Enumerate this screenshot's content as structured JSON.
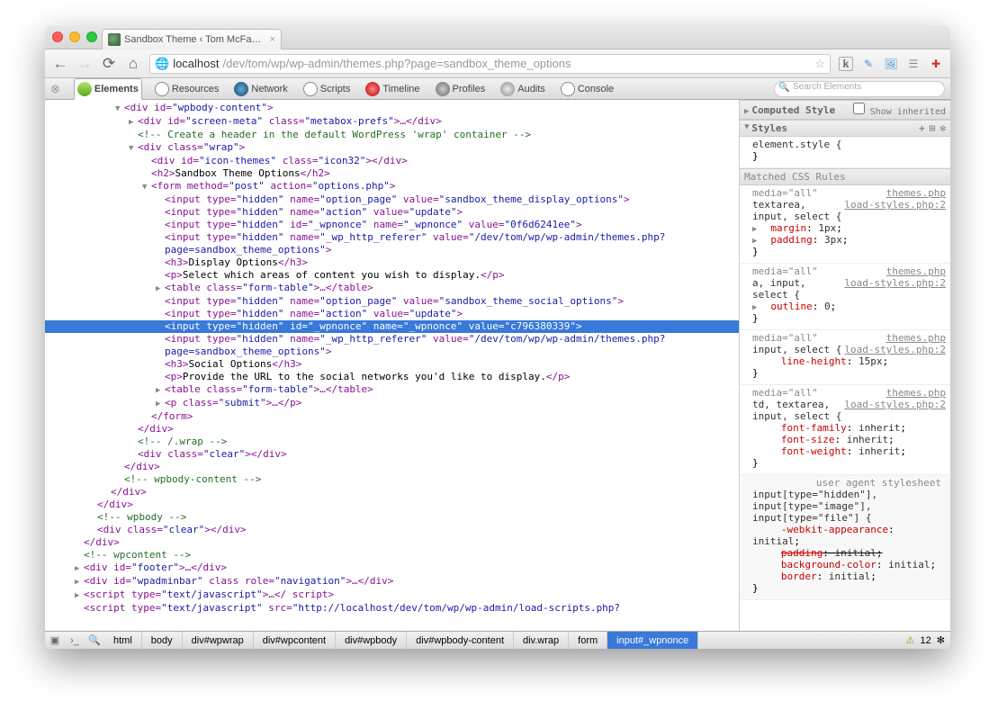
{
  "tab": {
    "title": "Sandbox Theme ‹ Tom McFa…",
    "close": "×"
  },
  "url": {
    "host": "localhost",
    "rest": "/dev/tom/wp/wp-admin/themes.php?page=sandbox_theme_options"
  },
  "dt_tabs": {
    "elements": "Elements",
    "resources": "Resources",
    "network": "Network",
    "scripts": "Scripts",
    "timeline": "Timeline",
    "profiles": "Profiles",
    "audits": "Audits",
    "console": "Console"
  },
  "dt_search_placeholder": "Search Elements",
  "dom": {
    "l0": [
      "<div id=",
      "\"wpbody-content\"",
      ">"
    ],
    "l1": [
      "<div id=",
      "\"screen-meta\"",
      " class=",
      "\"metabox-prefs\"",
      ">…</div>"
    ],
    "l2": "<!-- Create a header in the default WordPress 'wrap' container -->",
    "l3": [
      "<div class=",
      "\"wrap\"",
      ">"
    ],
    "l4": [
      "<div id=",
      "\"icon-themes\"",
      " class=",
      "\"icon32\"",
      "></div>"
    ],
    "l5": [
      "<h2>",
      "Sandbox Theme Options",
      "</h2>"
    ],
    "l6": [
      "<form method=",
      "\"post\"",
      " action=",
      "\"options.php\"",
      ">"
    ],
    "l7": [
      "<input type=",
      "\"hidden\"",
      " name=",
      "\"option_page\"",
      " value=",
      "\"sandbox_theme_display_options\"",
      ">"
    ],
    "l8": [
      "<input type=",
      "\"hidden\"",
      " name=",
      "\"action\"",
      " value=",
      "\"update\"",
      ">"
    ],
    "l9": [
      "<input type=",
      "\"hidden\"",
      " id=",
      "\"_wpnonce\"",
      " name=",
      "\"_wpnonce\"",
      " value=",
      "\"0f6d6241ee\"",
      ">"
    ],
    "l10a": [
      "<input type=",
      "\"hidden\"",
      " name=",
      "\"_wp_http_referer\"",
      " value=",
      "\"/dev/tom/wp/wp-admin/themes.php?"
    ],
    "l10b": [
      "page=sandbox_theme_options\"",
      ">"
    ],
    "l11": [
      "<h3>",
      "Display Options",
      "</h3>"
    ],
    "l12": [
      "<p>",
      "Select which areas of content you wish to display.",
      "</p>"
    ],
    "l13": [
      "<table class=",
      "\"form-table\"",
      ">…</table>"
    ],
    "l14": [
      "<input type=",
      "\"hidden\"",
      " name=",
      "\"option_page\"",
      " value=",
      "\"sandbox_theme_social_options\"",
      ">"
    ],
    "l15": [
      "<input type=",
      "\"hidden\"",
      " name=",
      "\"action\"",
      " value=",
      "\"update\"",
      ">"
    ],
    "l16": "<input type=\"hidden\" id=\"_wpnonce\" name=\"_wpnonce\" value=\"c796380339\">",
    "l17a": [
      "<input type=",
      "\"hidden\"",
      " name=",
      "\"_wp_http_referer\"",
      " value=",
      "\"/dev/tom/wp/wp-admin/themes.php?"
    ],
    "l17b": [
      "page=sandbox_theme_options\"",
      ">"
    ],
    "l18": [
      "<h3>",
      "Social Options",
      "</h3>"
    ],
    "l19": [
      "<p>",
      "Provide the URL to the social networks you'd like to display.",
      "</p>"
    ],
    "l20": [
      "<table class=",
      "\"form-table\"",
      ">…</table>"
    ],
    "l21": [
      "<p class=",
      "\"submit\"",
      ">…</p>"
    ],
    "l22": "</form>",
    "l23": "</div>",
    "l24": "<!-- /.wrap -->",
    "l25": [
      "<div class=",
      "\"clear\"",
      "></div>"
    ],
    "l26": "</div>",
    "l27": "<!-- wpbody-content -->",
    "l28": "</div>",
    "l29": "</div>",
    "l30": "<!-- wpbody -->",
    "l31": [
      "<div class=",
      "\"clear\"",
      "></div>"
    ],
    "l32": "</div>",
    "l33": "<!-- wpcontent -->",
    "l34": [
      "<div id=",
      "\"footer\"",
      ">…</div>"
    ],
    "l35": [
      "<div id=",
      "\"wpadminbar\"",
      " class role=",
      "\"navigation\"",
      ">…</div>"
    ],
    "l36": [
      "<script type=",
      "\"text/javascript\"",
      ">…</ script>"
    ],
    "l37": [
      "<script type=",
      "\"text/javascript\"",
      " src=",
      "\"http://localhost/dev/tom/wp/wp-admin/load-scripts.php?"
    ]
  },
  "styles": {
    "computed": "Computed Style",
    "computed_chk": "Show inherited",
    "styles_h": "Styles",
    "r0": {
      "sel": "element.style {",
      "close": "}"
    },
    "matched": "Matched CSS Rules",
    "r1": {
      "media": "media=\"all\"",
      "file": "themes.php",
      "sel": "textarea,",
      "file2": "load-styles.php:2",
      "sel2": "input, select {",
      "p1": "margin",
      "v1": "1px",
      "p2": "padding",
      "v2": "3px",
      "close": "}"
    },
    "r2": {
      "media": "media=\"all\"",
      "file": "themes.php",
      "sel": "a, input,",
      "file2": "load-styles.php:2",
      "sel2": "select {",
      "p1": "outline",
      "v1": "0",
      "close": "}"
    },
    "r3": {
      "media": "media=\"all\"",
      "file": "themes.php",
      "sel": "input, select {",
      "file2": "load-styles.php:2",
      "p1": "line-height",
      "v1": "15px",
      "close": "}"
    },
    "r4": {
      "media": "media=\"all\"",
      "file": "themes.php",
      "sel": "td, textarea,",
      "file2": "load-styles.php:2",
      "sel2": "input, select {",
      "p1": "font-family",
      "v1": "inherit",
      "p2": "font-size",
      "v2": "inherit",
      "p3": "font-weight",
      "v3": "inherit",
      "close": "}"
    },
    "r5": {
      "label": "user agent stylesheet",
      "sel": "input[type=\"hidden\"],",
      "sel2": "input[type=\"image\"],",
      "sel3": "input[type=\"file\"] {",
      "p1": "-webkit-appearance",
      "v1": "initial",
      "p2": "padding",
      "v2": "initial",
      "p3": "background-color",
      "v3": "initial",
      "p4": "border",
      "v4": "initial",
      "close": "}"
    }
  },
  "breadcrumb": [
    "html",
    "body",
    "div#wpwrap",
    "div#wpcontent",
    "div#wpbody",
    "div#wpbody-content",
    "div.wrap",
    "form",
    "input#_wpnonce"
  ],
  "warnings": "12"
}
